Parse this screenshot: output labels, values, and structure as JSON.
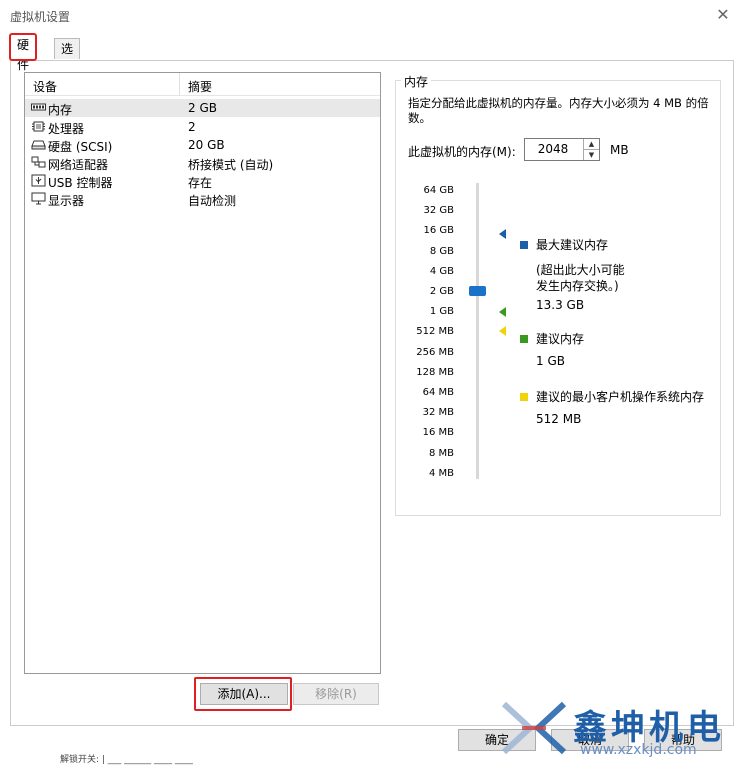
{
  "window": {
    "title": "虚拟机设置",
    "close_glyph": "✕"
  },
  "tabs": [
    {
      "label": "硬件"
    },
    {
      "label": "选项"
    }
  ],
  "device_list": {
    "headers": {
      "device": "设备",
      "summary": "摘要"
    },
    "rows": [
      {
        "name": "内存",
        "summary": "2 GB",
        "icon": "memory-icon"
      },
      {
        "name": "处理器",
        "summary": "2",
        "icon": "processor-icon"
      },
      {
        "name": "硬盘 (SCSI)",
        "summary": "20 GB",
        "icon": "hard-disk-icon"
      },
      {
        "name": "网络适配器",
        "summary": "桥接模式 (自动)",
        "icon": "network-adapter-icon"
      },
      {
        "name": "USB 控制器",
        "summary": "存在",
        "icon": "usb-icon"
      },
      {
        "name": "显示器",
        "summary": "自动检测",
        "icon": "display-icon"
      }
    ],
    "selected_index": 0
  },
  "buttons": {
    "add": "添加(A)...",
    "remove": "移除(R)"
  },
  "memory": {
    "group_label": "内存",
    "description": "指定分配给此虚拟机的内存量。内存大小必须为 4 MB 的倍数。",
    "field_label": "此虚拟机的内存(M):",
    "value": "2048",
    "unit": "MB",
    "scale_labels": [
      "64 GB",
      "32 GB",
      "16 GB",
      "8 GB",
      "4 GB",
      "2 GB",
      "1 GB",
      "512 MB",
      "256 MB",
      "128 MB",
      "64 MB",
      "32 MB",
      "16 MB",
      "8 MB",
      "4 MB"
    ],
    "legend": {
      "max_title": "最大建议内存",
      "max_note1": "(超出此大小可能",
      "max_note2": "发生内存交换。)",
      "max_value": "13.3 GB",
      "rec_title": "建议内存",
      "rec_value": "1 GB",
      "min_title": "建议的最小客户机操作系统内存",
      "min_value": "512 MB"
    },
    "colors": {
      "max": "#1a5fa8",
      "recommended": "#3a9a20",
      "minimum": "#f2d20a",
      "thumb": "#1a73c8"
    }
  },
  "footer": {
    "ok": "确定",
    "cancel": "取消",
    "help": "帮助"
  },
  "watermark": {
    "text": "鑫坤机电",
    "url": "www.xzxkjd.com"
  },
  "underlying_text": "解锁开关:  | ___ ______ ____ ____"
}
